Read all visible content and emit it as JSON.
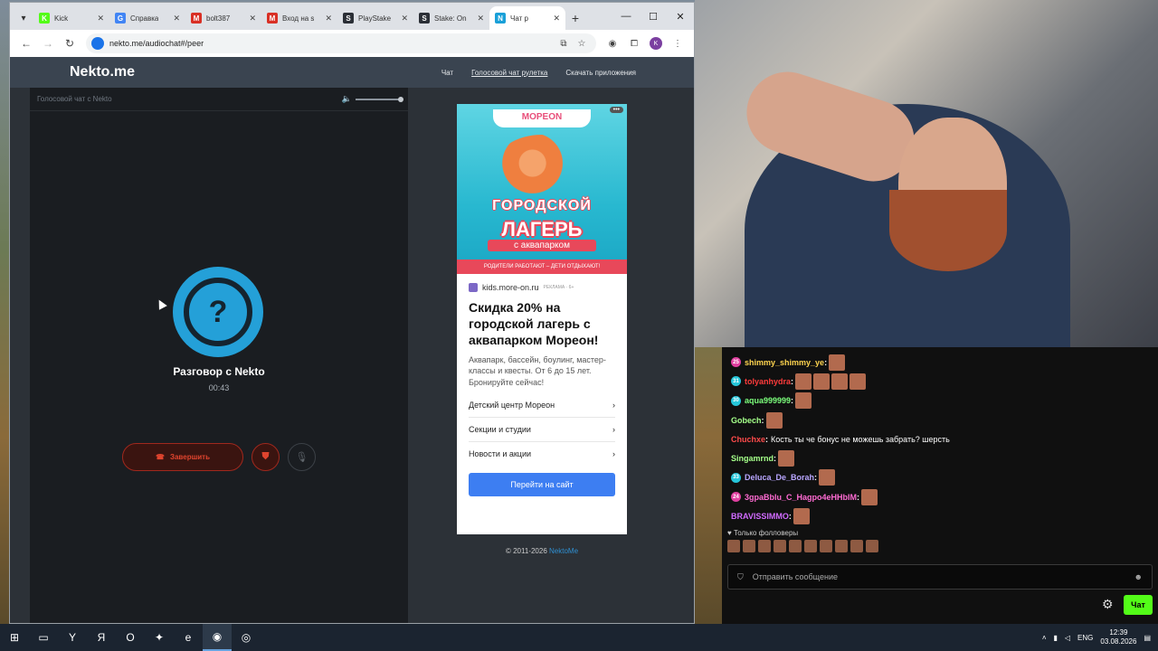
{
  "browser": {
    "tabs": [
      {
        "label": "Kick",
        "color": "#53fc18",
        "glyph": "K"
      },
      {
        "label": "Справка",
        "color": "#4285f4",
        "glyph": "G"
      },
      {
        "label": "bolt387",
        "color": "#d93025",
        "glyph": "M"
      },
      {
        "label": "Вход на s",
        "color": "#d93025",
        "glyph": "M"
      },
      {
        "label": "PlayStake",
        "color": "#2b2f36",
        "glyph": "S"
      },
      {
        "label": "Stake: On",
        "color": "#2b2f36",
        "glyph": "S"
      },
      {
        "label": "Чат р",
        "color": "#1aa0d8",
        "glyph": "N",
        "active": true
      }
    ],
    "url": "nekto.me/audiochat#/peer"
  },
  "site": {
    "logo": "Nekto.me",
    "nav": [
      "Чат",
      "Голосовой чат рулетка",
      "Скачать приложения"
    ]
  },
  "chat": {
    "header": "Голосовой чат с Nekto",
    "volume_level": 1.0,
    "avatar_glyph": "?",
    "title": "Разговор с Nekto",
    "timer": "00:43",
    "end_label": "Завершить"
  },
  "ad": {
    "brand": "MOPEON",
    "headline1": "ГОРОДСКОЙ",
    "headline2": "ЛАГЕРЬ",
    "headline3": "с аквапарком",
    "footer": "РОДИТЕЛИ РАБОТАЮТ – ДЕТИ ОТДЫХАЮТ!",
    "site": "kids.more-on.ru",
    "marker": "РЕКЛАМА · 6+",
    "title": "Скидка 20% на городской лагерь с аквапарком Мореон!",
    "description": "Аквапарк, бассейн, боулинг, мастер-классы и квесты. От 6 до 15 лет. Бронируйте сейчас!",
    "links": [
      "Детский центр Мореон",
      "Секции и студии",
      "Новости и акции"
    ],
    "cta": "Перейти на сайт"
  },
  "footer": {
    "copyright": "© 2011-2026",
    "brand": "NektoMe"
  },
  "stream_chat": {
    "messages": [
      {
        "badge": "25",
        "badge_color": "#e040a0",
        "user": "shimmy_shimmy_ye",
        "user_color": "#ffd54f",
        "text": "",
        "emotes": 1
      },
      {
        "badge": "31",
        "badge_color": "#26c6da",
        "user": "tolyanhydra",
        "user_color": "#ff3b3b",
        "text": "",
        "emotes": 4
      },
      {
        "badge": "30",
        "badge_color": "#26c6da",
        "user": "aqua999999",
        "user_color": "#7cff7c",
        "text": "",
        "emotes": 1
      },
      {
        "badge": "",
        "badge_color": "",
        "user": "Gobech",
        "user_color": "#a5ff8a",
        "text": "",
        "emotes": 1
      },
      {
        "badge": "",
        "badge_color": "",
        "user": "Chuchxe",
        "user_color": "#ff4b4b",
        "text": "Кость ты че бонус не можешь забрать? шерсть",
        "emotes": 0
      },
      {
        "badge": "",
        "badge_color": "",
        "user": "Singamrnd",
        "user_color": "#a5ff8a",
        "text": "",
        "emotes": 1
      },
      {
        "badge": "33",
        "badge_color": "#26c6da",
        "user": "Deluca_De_Borah",
        "user_color": "#b9a6ff",
        "text": "",
        "emotes": 1
      },
      {
        "badge": "24",
        "badge_color": "#e040a0",
        "user": "3gpaBblu_C_Hagpo4eHHbIM",
        "user_color": "#ff6bd3",
        "text": "",
        "emotes": 1
      },
      {
        "badge": "",
        "badge_color": "",
        "user": "BRAVISSIMMO",
        "user_color": "#d16bff",
        "text": "",
        "emotes": 1
      }
    ],
    "followers_note": "Только фолловеры",
    "input_placeholder": "Отправить сообщение",
    "send_label": "Чат"
  },
  "taskbar": {
    "tray_lang": "ENG",
    "time": "12:39",
    "date": "03.08.2026"
  }
}
